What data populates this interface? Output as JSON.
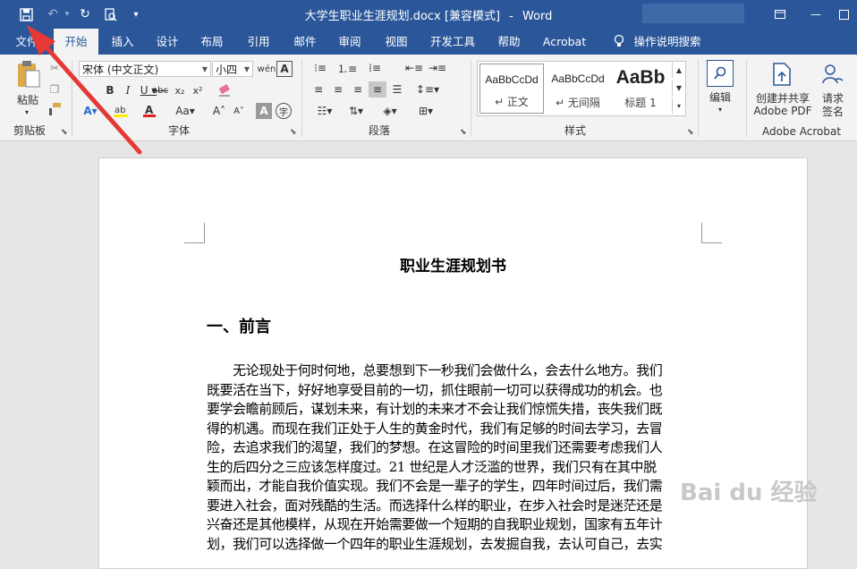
{
  "window": {
    "title": "大学生职业生涯规划.docx [兼容模式]",
    "app": "Word",
    "separator": "-"
  },
  "tabs": [
    "文件",
    "开始",
    "插入",
    "设计",
    "布局",
    "引用",
    "邮件",
    "审阅",
    "视图",
    "开发工具",
    "帮助",
    "Acrobat",
    "操作说明搜索"
  ],
  "ribbon": {
    "clipboard": {
      "paste": "粘贴",
      "label": "剪贴板"
    },
    "font": {
      "name": "宋体 (中文正文)",
      "size": "小四",
      "label": "字体"
    },
    "paragraph": {
      "label": "段落"
    },
    "styles": {
      "label": "样式",
      "items": [
        {
          "sample": "AaBbCcDd",
          "name": "↵ 正文"
        },
        {
          "sample": "AaBbCcDd",
          "name": "↵ 无间隔"
        },
        {
          "sample": "AaBb",
          "name": "标题 1"
        }
      ]
    },
    "editing": {
      "label": "编辑"
    },
    "acrobat": {
      "create_line1": "创建并共享",
      "create_line2": "Adobe PDF",
      "sign_line1": "请求",
      "sign_line2": "签名",
      "label": "Adobe Acrobat"
    }
  },
  "document": {
    "title": "职业生涯规划书",
    "heading": "一、前言",
    "lines": [
      "　　无论现处于何时何地，总要想到下一秒我们会做什么，会去什么地方。我们",
      "既要活在当下，好好地享受目前的一切，抓住眼前一切可以获得成功的机会。也",
      "要学会瞻前顾后，谋划未来，有计划的未来才不会让我们惊慌失措，丧失我们既",
      "得的机遇。而现在我们正处于人生的黄金时代，我们有足够的时间去学习，去冒",
      "险，去追求我们的渴望，我们的梦想。在这冒险的时间里我们还需要考虑我们人",
      "生的后四分之三应该怎样度过。21 世纪是人才泛滥的世界，我们只有在其中脱",
      "颖而出，才能自我价值实现。我们不会是一辈子的学生，四年时间过后，我们需",
      "要进入社会，面对残酷的生活。而选择什么样的职业，在步入社会时是迷茫还是",
      "兴奋还是其他模样，从现在开始需要做一个短期的自我职业规划，国家有五年计",
      "划，我们可以选择做一个四年的职业生涯规划，去发掘自我，去认可自己，去实"
    ]
  },
  "colors": {
    "brand": "#2b579a",
    "annotation_arrow": "#e53935"
  },
  "watermark": "Bai du 经验"
}
